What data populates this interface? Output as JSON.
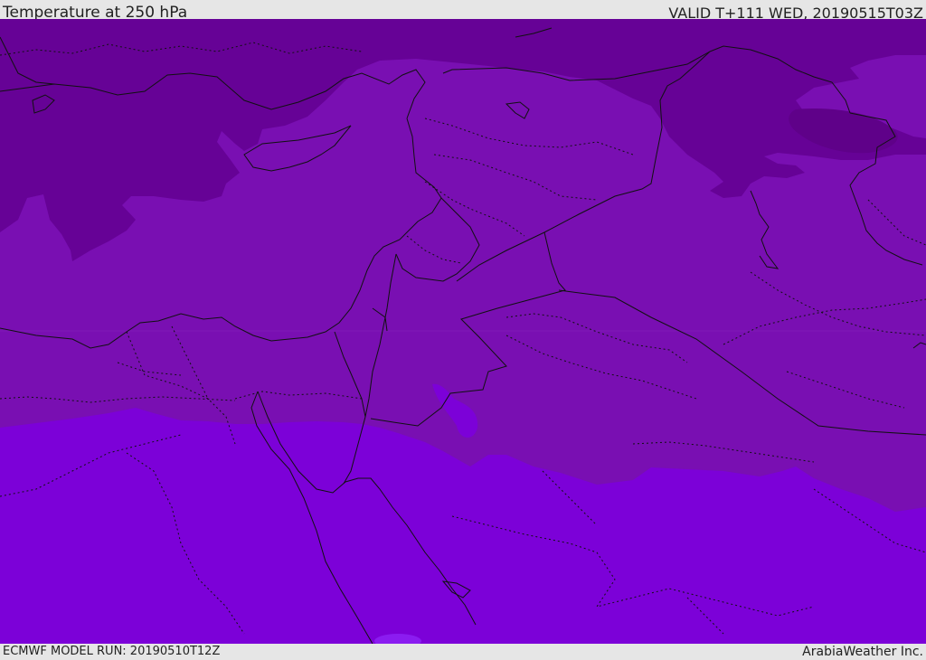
{
  "header": {
    "title": "Temperature at 250 hPa",
    "valid": "VALID T+111 WED, 20190515T03Z"
  },
  "footer": {
    "model_run": "ECMWF MODEL RUN: 20190510T12Z",
    "brand": "ArabiaWeather Inc."
  },
  "colors": {
    "coldest": "#660296",
    "cold": "#790fb2",
    "mid": "#7a0fb6",
    "warm": "#7c01d8",
    "warmest": "#8b1cf0",
    "border": "#111111"
  }
}
